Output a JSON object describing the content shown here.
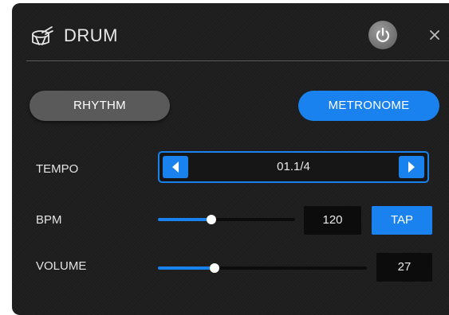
{
  "header": {
    "title": "DRUM",
    "icon": "drum-icon"
  },
  "controls": {
    "power_icon": "power-icon",
    "close_icon": "close-icon"
  },
  "modes": {
    "rhythm_label": "RHYTHM",
    "metronome_label": "METRONOME",
    "active": "METRONOME"
  },
  "tempo": {
    "label": "TEMPO",
    "value": "01.1/4"
  },
  "bpm": {
    "label": "BPM",
    "value": "120",
    "slider_fraction": 0.39,
    "tap_label": "TAP"
  },
  "volume": {
    "label": "VOLUME",
    "value": "27",
    "slider_fraction": 0.27
  },
  "colors": {
    "accent": "#1a82ee",
    "panel": "#1d1d1d",
    "inactive_pill": "#5a5a5a"
  }
}
